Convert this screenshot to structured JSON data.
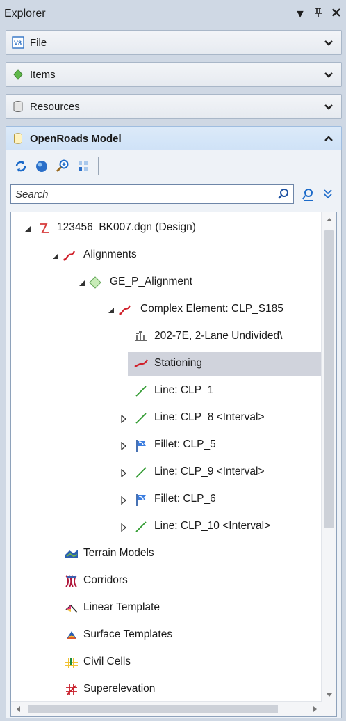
{
  "window": {
    "title": "Explorer",
    "controls": {
      "dropdown": "▼",
      "pin": "⊥",
      "close": "✕"
    }
  },
  "sections": [
    {
      "label": "File",
      "icon": "v8-file-icon"
    },
    {
      "label": "Items",
      "icon": "green-diamond-icon"
    },
    {
      "label": "Resources",
      "icon": "database-icon"
    },
    {
      "label": "OpenRoads Model",
      "icon": "database-yellow-icon"
    }
  ],
  "toolbar": {
    "buttons": [
      "refresh-icon",
      "globe-icon",
      "zoom-icon",
      "grid-icon"
    ]
  },
  "search": {
    "placeholder": "Search",
    "value": ""
  },
  "tree": [
    {
      "label": "123456_BK007.dgn (Design)",
      "icon": "design-file-icon",
      "expander": "expanded"
    },
    {
      "label": "Alignments",
      "icon": "alignment-icon",
      "expander": "expanded"
    },
    {
      "label": "GE_P_Alignment",
      "icon": "green-diamond-icon",
      "expander": "expanded"
    },
    {
      "label": "Complex Element: CLP_S185",
      "icon": "alignment-icon",
      "expander": "expanded"
    },
    {
      "label": "202-7E, 2-Lane Undivided\\",
      "icon": "cross-section-icon",
      "expander": "none"
    },
    {
      "label": "Stationing",
      "icon": "stationing-icon",
      "expander": "none",
      "selected": true
    },
    {
      "label": "Line: CLP_1",
      "icon": "line-icon",
      "expander": "none"
    },
    {
      "label": "Line: CLP_8 <Interval>",
      "icon": "line-icon",
      "expander": "collapsed"
    },
    {
      "label": "Fillet: CLP_5",
      "icon": "fillet-icon",
      "expander": "collapsed"
    },
    {
      "label": "Line: CLP_9 <Interval>",
      "icon": "line-icon",
      "expander": "collapsed"
    },
    {
      "label": "Fillet: CLP_6",
      "icon": "fillet-icon",
      "expander": "collapsed"
    },
    {
      "label": "Line: CLP_10 <Interval>",
      "icon": "line-icon",
      "expander": "collapsed"
    },
    {
      "label": "Terrain Models",
      "icon": "terrain-icon",
      "expander": "none"
    },
    {
      "label": "Corridors",
      "icon": "corridor-icon",
      "expander": "none"
    },
    {
      "label": "Linear Template",
      "icon": "linear-template-icon",
      "expander": "none"
    },
    {
      "label": "Surface Templates",
      "icon": "surface-template-icon",
      "expander": "none"
    },
    {
      "label": "Civil Cells",
      "icon": "civil-cells-icon",
      "expander": "none"
    },
    {
      "label": "Superelevation",
      "icon": "superelevation-icon",
      "expander": "none"
    }
  ],
  "colors": {
    "titlebar": "#cfd8e4",
    "selection": "#d0d3dc",
    "accent": "#1b6ac9"
  }
}
